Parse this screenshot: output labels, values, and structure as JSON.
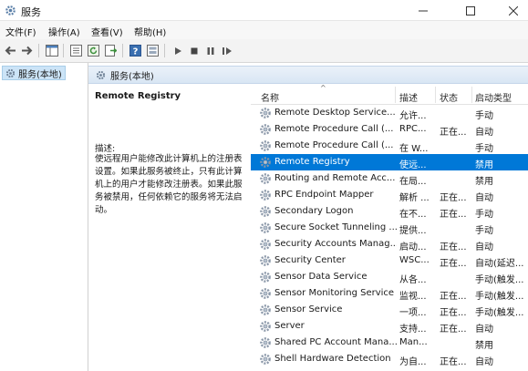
{
  "window": {
    "title": "服务",
    "icon": "gear-icon",
    "controls": [
      "minimize-icon",
      "maximize-icon",
      "close-icon"
    ]
  },
  "menu": [
    "文件(F)",
    "操作(A)",
    "查看(V)",
    "帮助(H)"
  ],
  "toolbar": {
    "icons": [
      "back-icon",
      "forward-icon",
      "show-hide-tree-icon",
      "properties-icon",
      "refresh-icon",
      "export-icon",
      "help-icon",
      "view-icon",
      "start-icon",
      "stop-icon",
      "pause-icon",
      "restart-icon"
    ]
  },
  "tree": {
    "item_label": "服务(本地)"
  },
  "main": {
    "header_label": "服务(本地)",
    "description": {
      "title": "Remote Registry",
      "label": "描述:",
      "body": "使远程用户能修改此计算机上的注册表设置。如果此服务被终止，只有此计算机上的用户才能修改注册表。如果此服务被禁用，任何依赖它的服务将无法启动。"
    },
    "columns": {
      "name": "名称",
      "desc": "描述",
      "status": "状态",
      "startup": "启动类型"
    },
    "rows": [
      {
        "name": "Remote Desktop Service...",
        "desc": "允许...",
        "status": "",
        "startup": "手动",
        "selected": false
      },
      {
        "name": "Remote Procedure Call (...",
        "desc": "RPC...",
        "status": "正在...",
        "startup": "自动",
        "selected": false
      },
      {
        "name": "Remote Procedure Call (...",
        "desc": "在 W...",
        "status": "",
        "startup": "手动",
        "selected": false
      },
      {
        "name": "Remote Registry",
        "desc": "使远...",
        "status": "",
        "startup": "禁用",
        "selected": true
      },
      {
        "name": "Routing and Remote Acc...",
        "desc": "在局...",
        "status": "",
        "startup": "禁用",
        "selected": false
      },
      {
        "name": "RPC Endpoint Mapper",
        "desc": "解析 ...",
        "status": "正在...",
        "startup": "自动",
        "selected": false
      },
      {
        "name": "Secondary Logon",
        "desc": "在不...",
        "status": "正在...",
        "startup": "手动",
        "selected": false
      },
      {
        "name": "Secure Socket Tunneling ...",
        "desc": "提供...",
        "status": "",
        "startup": "手动",
        "selected": false
      },
      {
        "name": "Security Accounts Manag...",
        "desc": "启动...",
        "status": "正在...",
        "startup": "自动",
        "selected": false
      },
      {
        "name": "Security Center",
        "desc": "WSC...",
        "status": "正在...",
        "startup": "自动(延迟...",
        "selected": false
      },
      {
        "name": "Sensor Data Service",
        "desc": "从各...",
        "status": "",
        "startup": "手动(触发...",
        "selected": false
      },
      {
        "name": "Sensor Monitoring Service",
        "desc": "监视...",
        "status": "正在...",
        "startup": "手动(触发...",
        "selected": false
      },
      {
        "name": "Sensor Service",
        "desc": "一项...",
        "status": "正在...",
        "startup": "手动(触发...",
        "selected": false
      },
      {
        "name": "Server",
        "desc": "支持...",
        "status": "正在...",
        "startup": "自动",
        "selected": false
      },
      {
        "name": "Shared PC Account Mana...",
        "desc": "Man...",
        "status": "",
        "startup": "禁用",
        "selected": false
      },
      {
        "name": "Shell Hardware Detection",
        "desc": "为自...",
        "status": "正在...",
        "startup": "自动",
        "selected": false
      }
    ]
  },
  "colors": {
    "selection": "#0078d7",
    "tree_selection": "#cce4f7",
    "header_gradient_top": "#eaf1f9",
    "header_gradient_bottom": "#d9e6f4"
  }
}
